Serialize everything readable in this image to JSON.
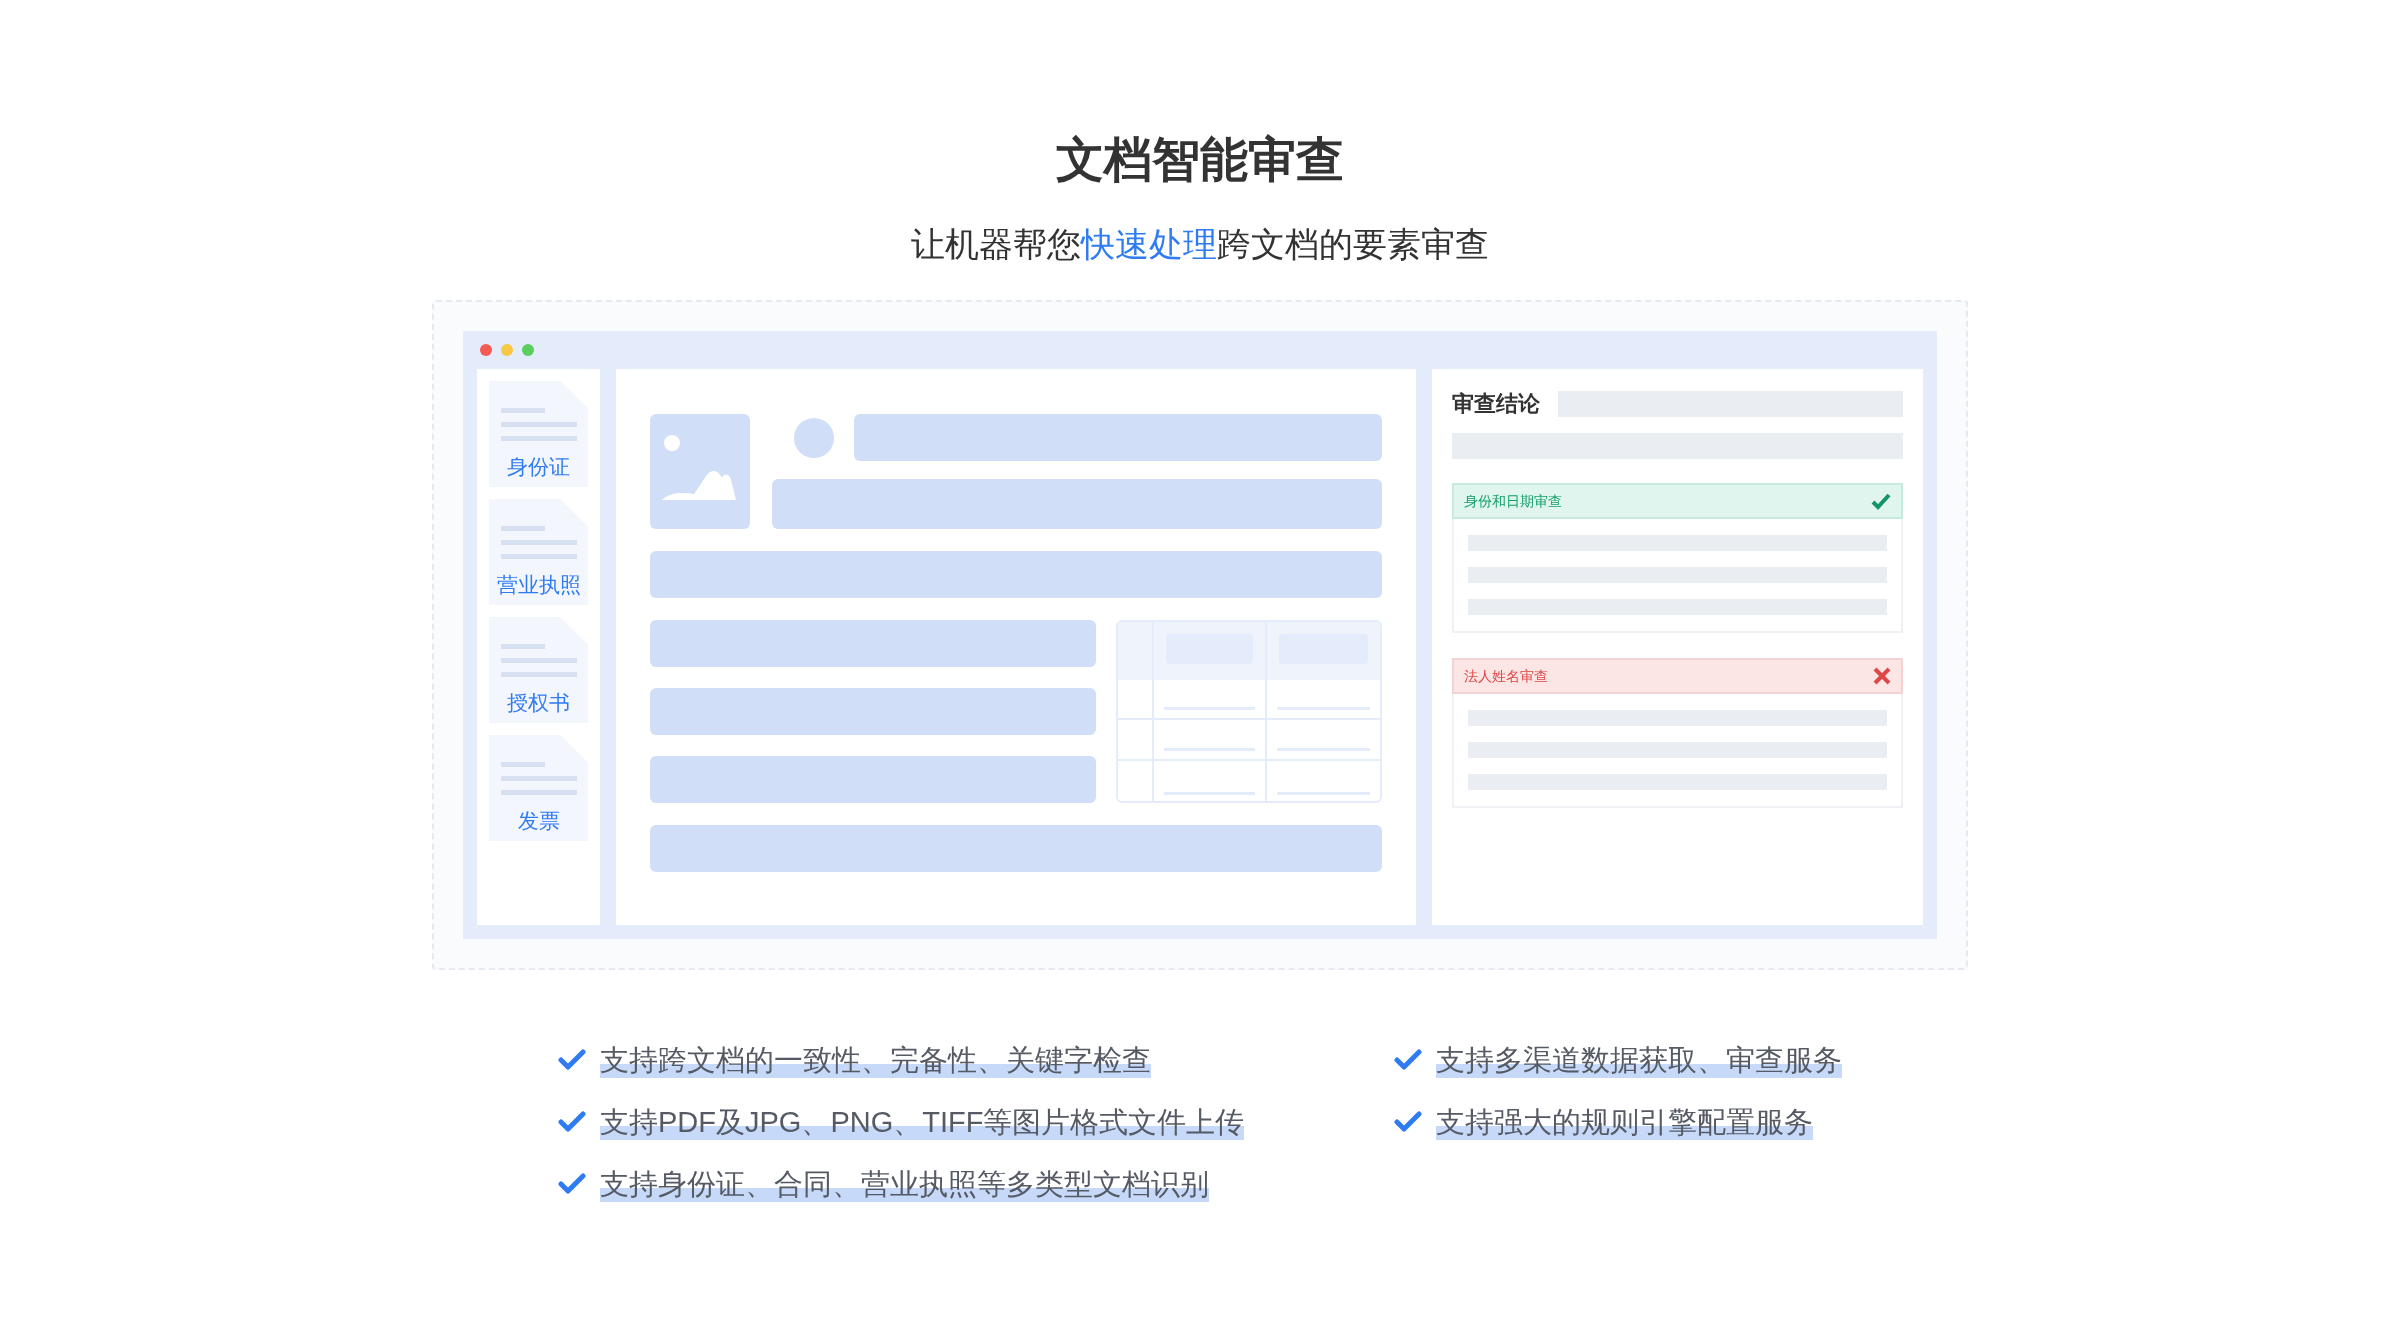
{
  "title": "文档智能审查",
  "subtitle": {
    "before": "让机器帮您",
    "highlighted": "快速处理",
    "after": "跨文档的要素审查"
  },
  "documents": [
    {
      "label": "身份证"
    },
    {
      "label": "营业执照"
    },
    {
      "label": "授权书"
    },
    {
      "label": "发票"
    }
  ],
  "review": {
    "heading": "审查结论",
    "checks": [
      {
        "label": "身份和日期审查",
        "kind": "pass"
      },
      {
        "label": "法人姓名审查",
        "kind": "fail"
      }
    ]
  },
  "features_left": [
    "支持跨文档的一致性、完备性、关键字检查",
    "支持PDF及JPG、PNG、TIFF等图片格式文件上传",
    "支持身份证、合同、营业执照等多类型文档识别"
  ],
  "features_right": [
    "支持多渠道数据获取、审查服务",
    "支持强大的规则引擎配置服务"
  ]
}
